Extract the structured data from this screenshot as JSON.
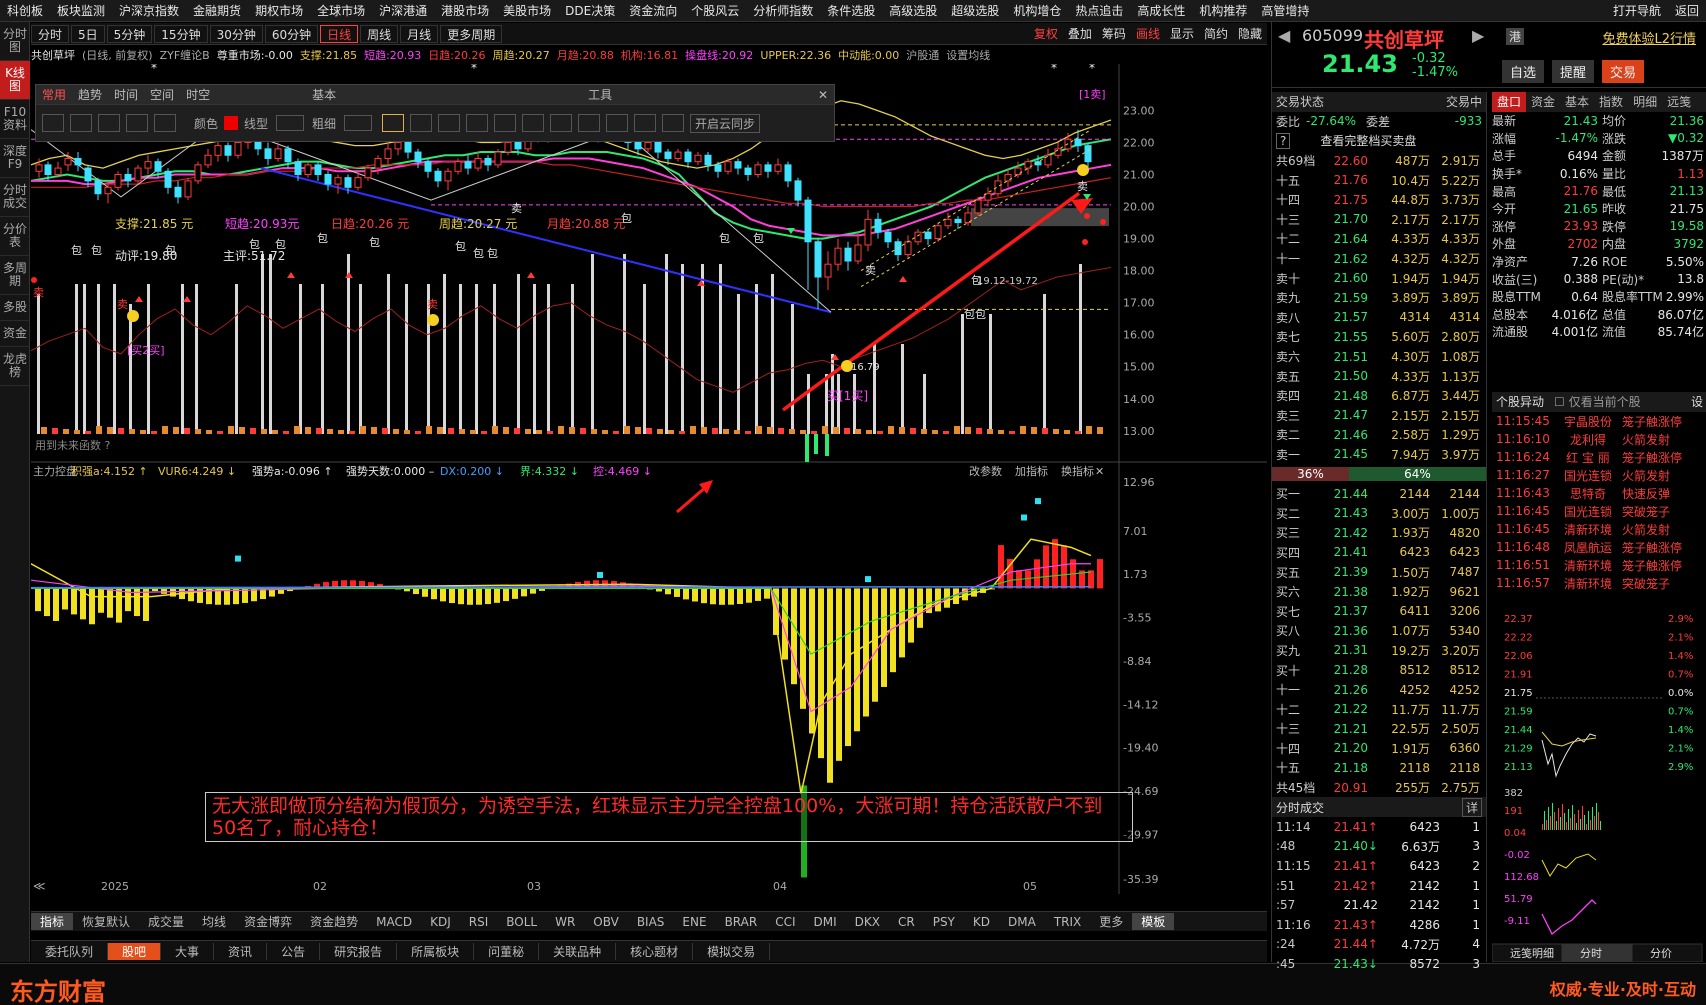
{
  "menu": [
    "科创板",
    "板块监测",
    "沪深京指数",
    "金融期货",
    "期权市场",
    "全球市场",
    "沪深港通",
    "港股市场",
    "美股市场",
    "DDE决策",
    "资金流向",
    "个股风云",
    "分析师指数",
    "条件选股",
    "高级选股",
    "超级选股",
    "机构增仓",
    "热点追击",
    "高成长性",
    "机构推荐",
    "高管增持"
  ],
  "menu_right": [
    "打开导航",
    "返回"
  ],
  "leftbar": [
    "分时图",
    "K线图",
    "F10资料",
    "深度F9",
    "分时成交",
    "分价表",
    "多周期",
    "多股",
    "资金",
    "龙虎榜"
  ],
  "periods": [
    "分时",
    "5日",
    "5分钟",
    "15分钟",
    "30分钟",
    "60分钟",
    "日线",
    "周线",
    "月线",
    "更多周期"
  ],
  "period_right": [
    "复权",
    "叠加",
    "筹码",
    "画线",
    "显示",
    "简约",
    "隐藏"
  ],
  "colors": {
    "up": "#ff3b3b",
    "down": "#2ee870",
    "yellow": "#e6c64a",
    "brand": "#e3501b"
  },
  "infoline": [
    {
      "t": "共创草坪",
      "c": "#e6e6e6"
    },
    {
      "t": "(日线, 前复权)",
      "c": "#aaaaaa"
    },
    {
      "t": "ZYF缠论B",
      "c": "#aaaaaa"
    },
    {
      "t": "尊重市场:-0.00",
      "c": "#e6e6e6"
    },
    {
      "t": "支撑:21.85",
      "c": "#e6c64a"
    },
    {
      "t": "短趋:20.93",
      "c": "#ff40ff"
    },
    {
      "t": "日趋:20.26",
      "c": "#ff3b3b"
    },
    {
      "t": "周趋:20.27",
      "c": "#e6c64a"
    },
    {
      "t": "月趋:20.88",
      "c": "#ff3b3b"
    },
    {
      "t": "机构:16.81",
      "c": "#ff3b3b"
    },
    {
      "t": "操盘线:20.92",
      "c": "#ff40ff"
    },
    {
      "t": "UPPER:22.36",
      "c": "#e6c64a"
    },
    {
      "t": "中动能:0.00",
      "c": "#e6c64a"
    },
    {
      "t": "沪股通",
      "c": "#aaaaaa"
    },
    {
      "t": "设置均线",
      "c": "#aaaaaa"
    }
  ],
  "tool_panel": {
    "tabs": [
      "常用",
      "趋势",
      "时间",
      "空间",
      "时空"
    ],
    "sec1": "基本",
    "sec2": "工具",
    "color_label": "颜色",
    "line_label": "线型",
    "width_label": "粗细",
    "sync_label": "开启云同步"
  },
  "price_axis": [
    "23.00",
    "22.00",
    "21.00",
    "20.00",
    "19.00",
    "18.00",
    "17.00",
    "16.00",
    "15.00",
    "14.00",
    "13.00"
  ],
  "indicator_axis": [
    "12.96",
    "7.01",
    "1.73",
    "-3.55",
    "-8.84",
    "-14.12",
    "-19.40",
    "-24.69",
    "-29.97",
    "-35.39"
  ],
  "chart_labels": {
    "support": "支撑:21.85 元",
    "short_trend": "短趋:20.93元",
    "day_trend": "日趋:20.26 元",
    "week_trend": "周趋:20.27 元",
    "month_trend": "月趋:20.88 元",
    "dong_ping": "动评:19.80",
    "zhong_ping": "主评:51.72",
    "sell_marker": "卖",
    "buy_label_2": "[买2买]",
    "buy_label_1": "买[1买]",
    "low_mark": "16.79",
    "range_mark": "19.12-19.72",
    "top_tag": "[1卖]",
    "future_func": "用到未来函数 ?",
    "bao": "包"
  },
  "indicator_line": [
    {
      "t": "主力控盘",
      "c": "#aaaaaa"
    },
    {
      "t": "积强a:4.152 ↑",
      "c": "#e6c64a"
    },
    {
      "t": "VUR6:4.249 ↓",
      "c": "#e6c64a"
    },
    {
      "t": "强势a:-0.096 ↑",
      "c": "#e6e6e6"
    },
    {
      "t": "强势天数:0.000 –",
      "c": "#e6e6e6"
    },
    {
      "t": "DX:0.200 ↓",
      "c": "#40a0ff"
    },
    {
      "t": "界:4.332 ↓",
      "c": "#2ee870"
    },
    {
      "t": "控:4.469 ↓",
      "c": "#ff40ff"
    }
  ],
  "indicator_btns": [
    "改参数",
    "加指标",
    "换指标"
  ],
  "note": "无大涨即做顶分结构为假顶分，为诱空手法，红珠显示主力完全控盘100%，大涨可期！持仓活跃散户不到50名了，耐心持仓！",
  "x_axis": [
    "2025",
    "02",
    "03",
    "04",
    "05"
  ],
  "indicator_tabs": [
    "指标",
    "恢复默认",
    "成交量",
    "均线",
    "资金博弈",
    "资金趋势",
    "MACD",
    "KDJ",
    "RSI",
    "BOLL",
    "WR",
    "OBV",
    "BIAS",
    "ENE",
    "BRAR",
    "CCI",
    "DMI",
    "DKX",
    "CR",
    "PSY",
    "KD",
    "DMA",
    "TRIX",
    "更多",
    "模板"
  ],
  "bottom_tabs": [
    "委托队列",
    "股吧",
    "大事",
    "资讯",
    "公告",
    "研究报告",
    "所属板块",
    "问董秘",
    "关联品种",
    "核心题材",
    "模拟交易"
  ],
  "footer": {
    "logo": "东方财富",
    "slogan": "权威·专业·及时·互动"
  },
  "stock": {
    "code": "605099",
    "name": "共创草坪",
    "price": "21.43",
    "change": "-0.32",
    "pct": "-1.47%",
    "promo": "免费体验L2行情"
  },
  "stock_btns": [
    "自选",
    "提醒",
    "交易"
  ],
  "trade": {
    "title": "交易状态",
    "right": "交易中",
    "ratio_label": "委比",
    "ratio": "-27.64%",
    "diff_label": "委差",
    "diff": "-933",
    "full_q": "查看完整档买卖盘",
    "sum_sell": {
      "l": "共69档",
      "p": "22.60",
      "v": "487万",
      "s": "2.91万"
    },
    "asks": [
      {
        "l": "十五",
        "p": "21.76",
        "v": "10.4万",
        "s": "5.22万"
      },
      {
        "l": "十四",
        "p": "21.75",
        "v": "44.8万",
        "s": "3.73万"
      },
      {
        "l": "十三",
        "p": "21.70",
        "v": "2.17万",
        "s": "2.17万"
      },
      {
        "l": "十二",
        "p": "21.64",
        "v": "4.33万",
        "s": "4.33万"
      },
      {
        "l": "十一",
        "p": "21.62",
        "v": "4.32万",
        "s": "4.32万"
      },
      {
        "l": "卖十",
        "p": "21.60",
        "v": "1.94万",
        "s": "1.94万"
      },
      {
        "l": "卖九",
        "p": "21.59",
        "v": "3.89万",
        "s": "3.89万"
      },
      {
        "l": "卖八",
        "p": "21.57",
        "v": "4314",
        "s": "4314"
      },
      {
        "l": "卖七",
        "p": "21.55",
        "v": "5.60万",
        "s": "2.80万"
      },
      {
        "l": "卖六",
        "p": "21.51",
        "v": "4.30万",
        "s": "1.08万"
      },
      {
        "l": "卖五",
        "p": "21.50",
        "v": "4.33万",
        "s": "1.13万"
      },
      {
        "l": "卖四",
        "p": "21.48",
        "v": "6.87万",
        "s": "3.44万"
      },
      {
        "l": "卖三",
        "p": "21.47",
        "v": "2.15万",
        "s": "2.15万"
      },
      {
        "l": "卖二",
        "p": "21.46",
        "v": "2.58万",
        "s": "1.29万"
      },
      {
        "l": "卖一",
        "p": "21.45",
        "v": "7.94万",
        "s": "3.97万"
      }
    ],
    "bar_left": "36%",
    "bar_right": "64%",
    "bids": [
      {
        "l": "买一",
        "p": "21.44",
        "v": "2144",
        "s": "2144"
      },
      {
        "l": "买二",
        "p": "21.43",
        "v": "3.00万",
        "s": "1.00万"
      },
      {
        "l": "买三",
        "p": "21.42",
        "v": "1.93万",
        "s": "4820"
      },
      {
        "l": "买四",
        "p": "21.41",
        "v": "6423",
        "s": "6423"
      },
      {
        "l": "买五",
        "p": "21.39",
        "v": "1.50万",
        "s": "7487"
      },
      {
        "l": "买六",
        "p": "21.38",
        "v": "1.92万",
        "s": "9621"
      },
      {
        "l": "买七",
        "p": "21.37",
        "v": "6411",
        "s": "3206"
      },
      {
        "l": "买八",
        "p": "21.36",
        "v": "1.07万",
        "s": "5340"
      },
      {
        "l": "买九",
        "p": "21.31",
        "v": "19.2万",
        "s": "3.20万"
      },
      {
        "l": "买十",
        "p": "21.28",
        "v": "8512",
        "s": "8512"
      },
      {
        "l": "十一",
        "p": "21.26",
        "v": "4252",
        "s": "4252"
      },
      {
        "l": "十二",
        "p": "21.22",
        "v": "11.7万",
        "s": "11.7万"
      },
      {
        "l": "十三",
        "p": "21.21",
        "v": "22.5万",
        "s": "2.50万"
      },
      {
        "l": "十四",
        "p": "21.20",
        "v": "1.91万",
        "s": "6360"
      },
      {
        "l": "十五",
        "p": "21.18",
        "v": "2118",
        "s": "2118"
      }
    ],
    "sum_buy": {
      "l": "共45档",
      "p": "20.91",
      "v": "255万",
      "s": "2.75万"
    },
    "ticks_title": "分时成交",
    "ticks_btn": "详",
    "ticks": [
      {
        "t": "11:14",
        "p": "21.41↑",
        "v": "6423",
        "n": "1",
        "d": "up"
      },
      {
        "t": ":48",
        "p": "21.40↓",
        "v": "6.63万",
        "n": "3",
        "d": "dn"
      },
      {
        "t": "11:15",
        "p": "21.41↑",
        "v": "6423",
        "n": "2",
        "d": "up"
      },
      {
        "t": ":51",
        "p": "21.42↑",
        "v": "2142",
        "n": "1",
        "d": "up"
      },
      {
        "t": ":57",
        "p": "21.42",
        "v": "2142",
        "n": "1",
        "d": "wt"
      },
      {
        "t": "11:16",
        "p": "21.43↑",
        "v": "4286",
        "n": "1",
        "d": "up"
      },
      {
        "t": ":24",
        "p": "21.44↑",
        "v": "4.72万",
        "n": "4",
        "d": "up"
      },
      {
        "t": ":45",
        "p": "21.43↓",
        "v": "8572",
        "n": "3",
        "d": "dn"
      }
    ]
  },
  "quote": {
    "tabs": [
      "盘口",
      "资金",
      "基本",
      "指数",
      "明细",
      "远笺"
    ],
    "rows": [
      {
        "k": "最新",
        "v": "21.43",
        "c": "dn",
        "k2": "均价",
        "v2": "21.36",
        "c2": "dn"
      },
      {
        "k": "涨幅",
        "v": "-1.47%",
        "c": "dn",
        "k2": "涨跌",
        "v2": "▼0.32",
        "c2": "dn"
      },
      {
        "k": "总手",
        "v": "6494",
        "c": "wt",
        "k2": "金额",
        "v2": "1387万",
        "c2": "wt"
      },
      {
        "k": "换手*",
        "v": "0.16%",
        "c": "wt",
        "k2": "量比",
        "v2": "1.13",
        "c2": "up"
      },
      {
        "k": "最高",
        "v": "21.76",
        "c": "up",
        "k2": "最低",
        "v2": "21.13",
        "c2": "dn"
      },
      {
        "k": "今开",
        "v": "21.65",
        "c": "dn",
        "k2": "昨收",
        "v2": "21.75",
        "c2": "wt"
      },
      {
        "k": "涨停",
        "v": "23.93",
        "c": "up",
        "k2": "跌停",
        "v2": "19.58",
        "c2": "dn"
      },
      {
        "k": "外盘",
        "v": "2702",
        "c": "up",
        "k2": "内盘",
        "v2": "3792",
        "c2": "dn"
      },
      {
        "k": "净资产",
        "v": "7.26",
        "c": "wt",
        "k2": "ROE",
        "v2": "5.50%",
        "c2": "wt"
      },
      {
        "k": "收益(三)",
        "v": "0.388",
        "c": "wt",
        "k2": "PE(动)*",
        "v2": "13.8",
        "c2": "wt"
      },
      {
        "k": "股息TTM",
        "v": "0.64",
        "c": "wt",
        "k2": "股息率TTM",
        "v2": "2.99%",
        "c2": "wt"
      },
      {
        "k": "总股本",
        "v": "4.016亿",
        "c": "wt",
        "k2": "总值",
        "v2": "86.07亿",
        "c2": "wt"
      },
      {
        "k": "流通股",
        "v": "4.001亿",
        "c": "wt",
        "k2": "流值",
        "v2": "85.74亿",
        "c2": "wt"
      }
    ]
  },
  "alerts": {
    "title": "个股异动",
    "checkbox": "仅看当前个股",
    "set": "设",
    "rows": [
      {
        "t": "11:15:45",
        "n": "宇晶股份",
        "e": "笼子触涨停"
      },
      {
        "t": "11:16:10",
        "n": "龙利得",
        "e": "火箭发射"
      },
      {
        "t": "11:16:24",
        "n": "红 宝 丽",
        "e": "笼子触涨停"
      },
      {
        "t": "11:16:27",
        "n": "国光连锁",
        "e": "火箭发射"
      },
      {
        "t": "11:16:43",
        "n": "思特奇",
        "e": "快速反弹"
      },
      {
        "t": "11:16:45",
        "n": "国光连锁",
        "e": "突破笼子"
      },
      {
        "t": "11:16:45",
        "n": "清新环境",
        "e": "火箭发射"
      },
      {
        "t": "11:16:48",
        "n": "凤凰航运",
        "e": "笼子触涨停"
      },
      {
        "t": "11:16:51",
        "n": "清新环境",
        "e": "笼子触涨停"
      },
      {
        "t": "11:16:57",
        "n": "清新环境",
        "e": "突破笼子"
      }
    ]
  },
  "mini": {
    "left_axis": [
      "22.37",
      "22.22",
      "22.06",
      "21.91",
      "21.75",
      "21.59",
      "21.44",
      "21.29",
      "21.13"
    ],
    "right_axis": [
      "2.9%",
      "2.1%",
      "1.4%",
      "0.7%",
      "0.0%",
      "0.7%",
      "1.4%",
      "2.1%",
      "2.9%"
    ],
    "vol_axis": [
      "382",
      "191",
      "0.04",
      "-0.02",
      "112.68",
      "51.79",
      "-9.11"
    ],
    "top_vol": "382",
    "tabs": [
      "远笺明细",
      "分时",
      "分价"
    ]
  }
}
